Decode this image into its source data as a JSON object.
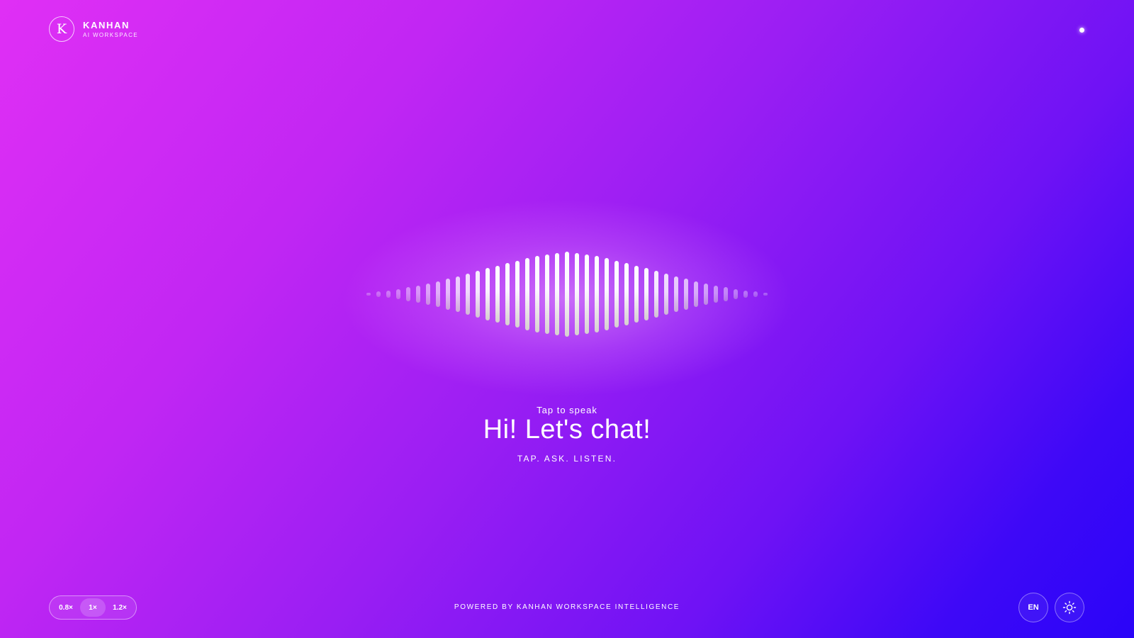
{
  "brand": {
    "logo_letter": "K",
    "name": "KANHAN",
    "subtitle": "AI WORKSPACE"
  },
  "status": {
    "indicator_color": "#ffffff"
  },
  "main": {
    "prompt": "Tap to speak",
    "headline": "Hi! Let's chat!",
    "tagline": "TAP. ASK. LISTEN."
  },
  "waveform": {
    "bar_count": 41,
    "bar_levels": [
      0.03,
      0.06,
      0.09,
      0.12,
      0.16,
      0.2,
      0.25,
      0.3,
      0.36,
      0.42,
      0.48,
      0.55,
      0.61,
      0.67,
      0.73,
      0.79,
      0.85,
      0.9,
      0.94,
      0.97,
      1.0,
      0.97,
      0.94,
      0.9,
      0.85,
      0.79,
      0.73,
      0.67,
      0.61,
      0.55,
      0.48,
      0.42,
      0.36,
      0.3,
      0.25,
      0.2,
      0.16,
      0.12,
      0.09,
      0.06,
      0.03
    ]
  },
  "footer": {
    "speed_options": [
      "0.8×",
      "1×",
      "1.2×"
    ],
    "selected_speed": "1×",
    "powered_by": "POWERED BY KANHAN WORKSPACE INTELLIGENCE",
    "language": "EN",
    "theme_icon": "sun-icon"
  },
  "colors": {
    "gradient_start": "#e02ff5",
    "gradient_mid": "#9a1ef3",
    "gradient_end": "#2a04f8",
    "text": "#ffffff"
  }
}
